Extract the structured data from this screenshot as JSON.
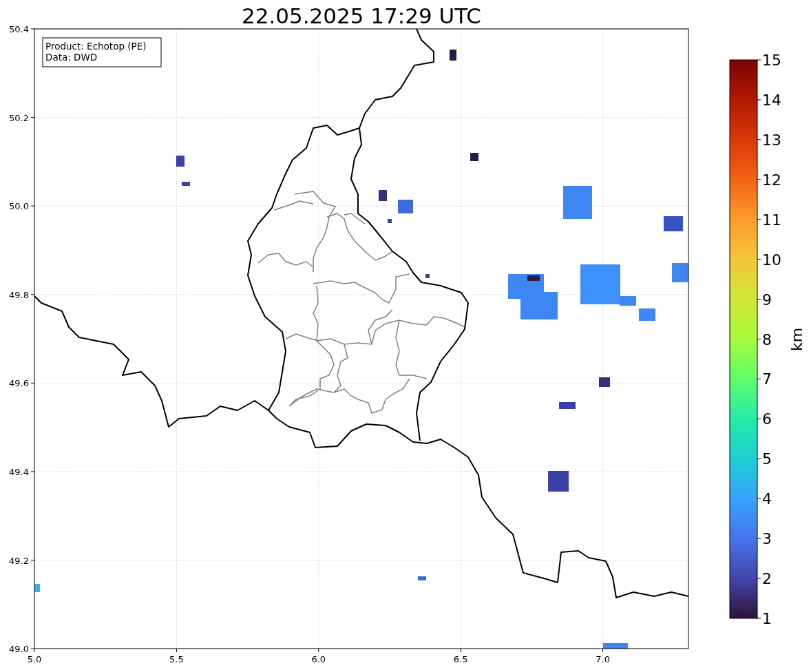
{
  "title": "22.05.2025 17:29 UTC",
  "legend_box": [
    "Product: Echotop (PE)",
    "Data: DWD"
  ],
  "x_axis": {
    "ticks": [
      "5.0",
      "5.5",
      "6.0",
      "6.5",
      "7.0"
    ]
  },
  "y_axis": {
    "ticks": [
      "50.4",
      "50.2",
      "50.0",
      "49.8",
      "49.6",
      "49.4",
      "49.2",
      "49.0"
    ]
  },
  "colorbar": {
    "label": "km",
    "ticks": [
      "15",
      "14",
      "13",
      "12",
      "11",
      "10",
      "9",
      "8",
      "7",
      "6",
      "5",
      "4",
      "3",
      "2",
      "1"
    ]
  }
}
